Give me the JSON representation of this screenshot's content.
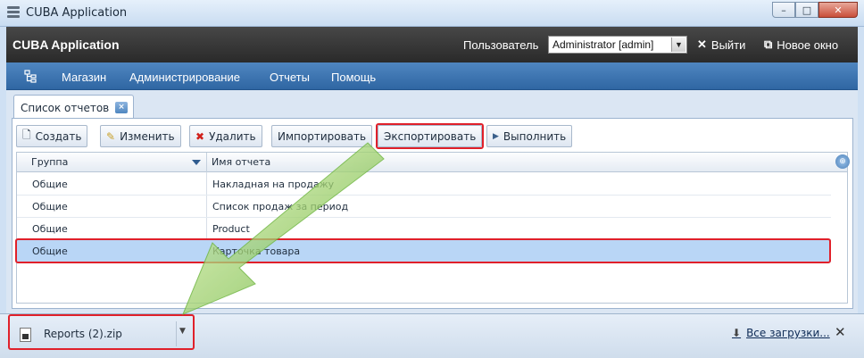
{
  "window": {
    "title": "CUBA Application",
    "controls": {
      "minimize": "–",
      "maximize": "□",
      "close": "✕"
    }
  },
  "header": {
    "app_name": "CUBA Application",
    "user_label": "Пользователь",
    "user_value": "Administrator [admin]",
    "logout_label": "Выйти",
    "new_window_label": "Новое окно"
  },
  "menu": {
    "items": [
      "Магазин",
      "Администрирование",
      "Отчеты",
      "Помощь"
    ]
  },
  "tab": {
    "label": "Список отчетов",
    "close": "×"
  },
  "toolbar": {
    "create": "Создать",
    "edit": "Изменить",
    "delete": "Удалить",
    "import": "Импортировать",
    "export": "Экспортировать",
    "run": "Выполнить"
  },
  "table": {
    "columns": [
      "Группа",
      "Имя отчета"
    ],
    "rows": [
      {
        "group": "Общие",
        "name": "Накладная на продажу"
      },
      {
        "group": "Общие",
        "name": "Список продаж за период"
      },
      {
        "group": "Общие",
        "name": "Product"
      },
      {
        "group": "Общие",
        "name": "Карточка товара"
      }
    ],
    "selected_row": 3
  },
  "downloads": {
    "file_name": "Reports (2).zip",
    "all_downloads": "Все загрузки...",
    "close": "✕"
  },
  "colors": {
    "highlight": "#e0202a",
    "menu_bar": "#3a72ae",
    "header_bg": "#333333",
    "selected_row": "#b9d6f6"
  }
}
